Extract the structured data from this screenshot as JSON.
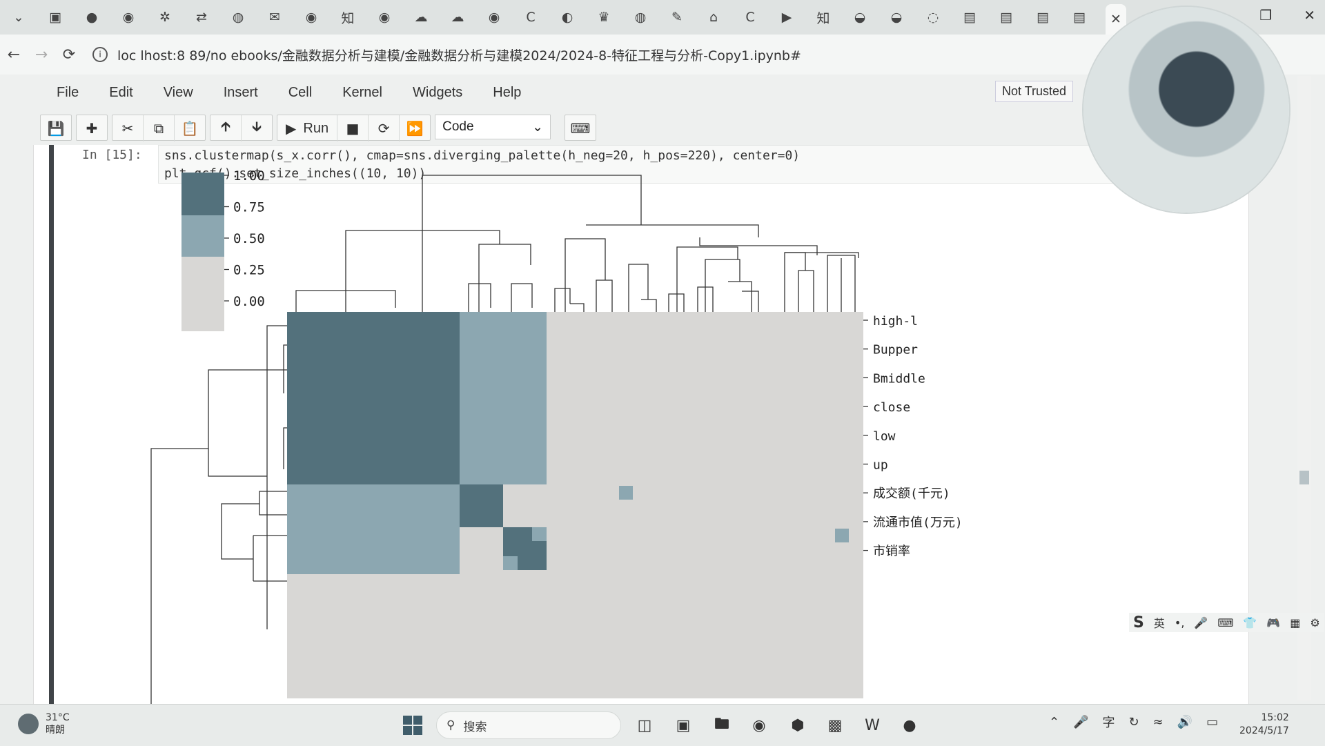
{
  "browser": {
    "tab_icons": [
      "chevron-down-icon",
      "calendar-icon",
      "record-icon",
      "github-icon",
      "puzzle-icon",
      "shuffle-icon",
      "globe-icon",
      "mail-icon",
      "github-icon",
      "zhihu-icon",
      "github-icon",
      "cloud-icon",
      "cloud-icon",
      "github-icon",
      "c-icon",
      "chat-icon",
      "crown-icon",
      "globe-icon",
      "feather-icon",
      "home-icon",
      "c-icon",
      "video-icon",
      "zhihu-icon",
      "disc-icon",
      "disc-icon",
      "loading-icon",
      "book-icon",
      "book-icon",
      "book-icon",
      "book-icon",
      "close-icon",
      "paw-icon"
    ],
    "url": "loc   lhost:8 89/no ebooks/金融数据分析与建模/金融数据分析与建模2024/2024-8-特征工程与分析-Copy1.ipynb#"
  },
  "jupyter": {
    "menu": [
      "File",
      "Edit",
      "View",
      "Insert",
      "Cell",
      "Kernel",
      "Widgets",
      "Help"
    ],
    "trust_label": "Not Trusted",
    "toolbar": {
      "run_label": "Run",
      "cell_type": "Code"
    },
    "cell": {
      "prompt": "In  [15]:",
      "code_line1": "sns.clustermap(s_x.corr(), cmap=sns.diverging_palette(h_neg=20, h_pos=220), center=0)",
      "code_line2": "plt.gcf().set_size_inches((10, 10))"
    }
  },
  "colors": {
    "dark": "#53717c",
    "mid": "#8ca7b1",
    "light": "#d8d7d5",
    "line": "#333333"
  },
  "chart_data": {
    "type": "heatmap",
    "colorbar_ticks": [
      "1.00",
      "0.75",
      "0.50",
      "0.25",
      "0.00"
    ],
    "row_labels": [
      "high-l",
      "Bupper",
      "Bmiddle",
      "close",
      "low",
      "up",
      "成交额(千元)",
      "流通市值(万元)",
      "市销率"
    ],
    "value_range": [
      0,
      1
    ],
    "levels": [
      "dark",
      "mid",
      "light"
    ],
    "blocks": [
      {
        "rows": [
          0,
          5
        ],
        "cols": [
          0,
          5
        ],
        "level": "dark"
      },
      {
        "rows": [
          0,
          5
        ],
        "cols": [
          6,
          8
        ],
        "level": "mid"
      },
      {
        "rows": [
          6,
          8
        ],
        "cols": [
          0,
          5
        ],
        "level": "mid"
      },
      {
        "rows": [
          6,
          7
        ],
        "cols": [
          6,
          7
        ],
        "level": "dark"
      },
      {
        "rows": [
          7,
          8
        ],
        "cols": [
          7,
          8
        ],
        "level": "dark"
      }
    ]
  },
  "ime": [
    "英",
    "•,",
    "mic-icon",
    "keyboard-icon",
    "shirt-icon",
    "gamepad-icon",
    "grid-icon",
    "gear-icon"
  ],
  "taskbar": {
    "weather_temp": "31°C",
    "weather_desc": "晴朗",
    "search_placeholder": "搜索",
    "time": "15:02",
    "date": "2024/5/17"
  }
}
